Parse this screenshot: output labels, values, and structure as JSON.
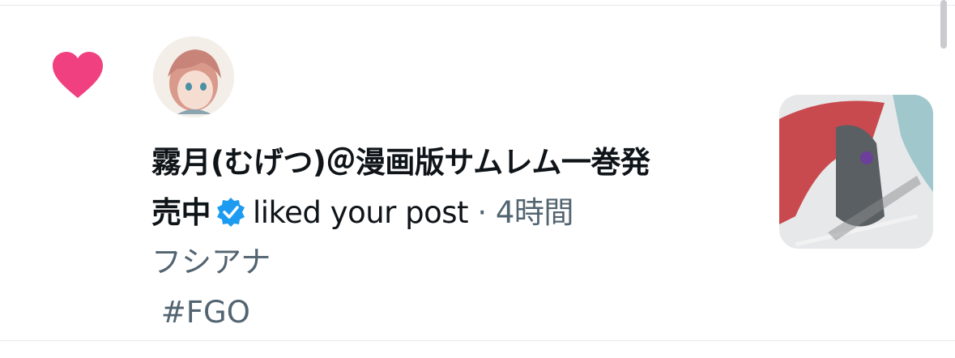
{
  "notification": {
    "type_icon": "heart-icon",
    "actor_avatar": "user-avatar",
    "actor_name": "霧月(むげつ)＠漫画版サムレム一巻発売中",
    "verified_icon": "verified-badge-icon",
    "action_text": "liked your post",
    "separator": "·",
    "time_ago": "4時間",
    "post_line1": "フシアナ",
    "post_line2": " #FGO",
    "post_thumbnail": "post-image"
  },
  "colors": {
    "heart": "#F0407F",
    "verified": "#1D9BF0",
    "secondary_text": "#536471",
    "primary_text": "#0F1419",
    "divider": "#E6E8EA"
  }
}
